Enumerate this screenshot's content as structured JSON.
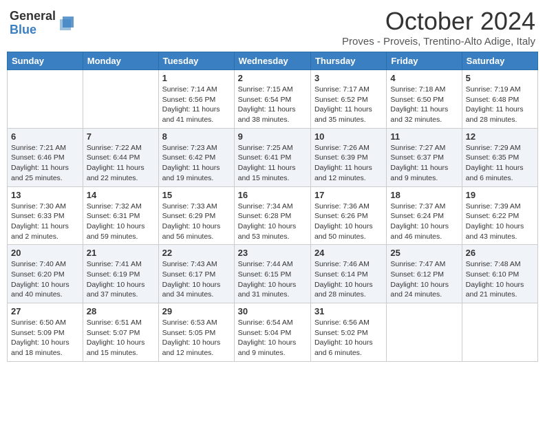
{
  "logo": {
    "general": "General",
    "blue": "Blue"
  },
  "title": "October 2024",
  "location": "Proves - Proveis, Trentino-Alto Adige, Italy",
  "days_of_week": [
    "Sunday",
    "Monday",
    "Tuesday",
    "Wednesday",
    "Thursday",
    "Friday",
    "Saturday"
  ],
  "weeks": [
    [
      {
        "day": "",
        "sunrise": "",
        "sunset": "",
        "daylight": ""
      },
      {
        "day": "",
        "sunrise": "",
        "sunset": "",
        "daylight": ""
      },
      {
        "day": "1",
        "sunrise": "Sunrise: 7:14 AM",
        "sunset": "Sunset: 6:56 PM",
        "daylight": "Daylight: 11 hours and 41 minutes."
      },
      {
        "day": "2",
        "sunrise": "Sunrise: 7:15 AM",
        "sunset": "Sunset: 6:54 PM",
        "daylight": "Daylight: 11 hours and 38 minutes."
      },
      {
        "day": "3",
        "sunrise": "Sunrise: 7:17 AM",
        "sunset": "Sunset: 6:52 PM",
        "daylight": "Daylight: 11 hours and 35 minutes."
      },
      {
        "day": "4",
        "sunrise": "Sunrise: 7:18 AM",
        "sunset": "Sunset: 6:50 PM",
        "daylight": "Daylight: 11 hours and 32 minutes."
      },
      {
        "day": "5",
        "sunrise": "Sunrise: 7:19 AM",
        "sunset": "Sunset: 6:48 PM",
        "daylight": "Daylight: 11 hours and 28 minutes."
      }
    ],
    [
      {
        "day": "6",
        "sunrise": "Sunrise: 7:21 AM",
        "sunset": "Sunset: 6:46 PM",
        "daylight": "Daylight: 11 hours and 25 minutes."
      },
      {
        "day": "7",
        "sunrise": "Sunrise: 7:22 AM",
        "sunset": "Sunset: 6:44 PM",
        "daylight": "Daylight: 11 hours and 22 minutes."
      },
      {
        "day": "8",
        "sunrise": "Sunrise: 7:23 AM",
        "sunset": "Sunset: 6:42 PM",
        "daylight": "Daylight: 11 hours and 19 minutes."
      },
      {
        "day": "9",
        "sunrise": "Sunrise: 7:25 AM",
        "sunset": "Sunset: 6:41 PM",
        "daylight": "Daylight: 11 hours and 15 minutes."
      },
      {
        "day": "10",
        "sunrise": "Sunrise: 7:26 AM",
        "sunset": "Sunset: 6:39 PM",
        "daylight": "Daylight: 11 hours and 12 minutes."
      },
      {
        "day": "11",
        "sunrise": "Sunrise: 7:27 AM",
        "sunset": "Sunset: 6:37 PM",
        "daylight": "Daylight: 11 hours and 9 minutes."
      },
      {
        "day": "12",
        "sunrise": "Sunrise: 7:29 AM",
        "sunset": "Sunset: 6:35 PM",
        "daylight": "Daylight: 11 hours and 6 minutes."
      }
    ],
    [
      {
        "day": "13",
        "sunrise": "Sunrise: 7:30 AM",
        "sunset": "Sunset: 6:33 PM",
        "daylight": "Daylight: 11 hours and 2 minutes."
      },
      {
        "day": "14",
        "sunrise": "Sunrise: 7:32 AM",
        "sunset": "Sunset: 6:31 PM",
        "daylight": "Daylight: 10 hours and 59 minutes."
      },
      {
        "day": "15",
        "sunrise": "Sunrise: 7:33 AM",
        "sunset": "Sunset: 6:29 PM",
        "daylight": "Daylight: 10 hours and 56 minutes."
      },
      {
        "day": "16",
        "sunrise": "Sunrise: 7:34 AM",
        "sunset": "Sunset: 6:28 PM",
        "daylight": "Daylight: 10 hours and 53 minutes."
      },
      {
        "day": "17",
        "sunrise": "Sunrise: 7:36 AM",
        "sunset": "Sunset: 6:26 PM",
        "daylight": "Daylight: 10 hours and 50 minutes."
      },
      {
        "day": "18",
        "sunrise": "Sunrise: 7:37 AM",
        "sunset": "Sunset: 6:24 PM",
        "daylight": "Daylight: 10 hours and 46 minutes."
      },
      {
        "day": "19",
        "sunrise": "Sunrise: 7:39 AM",
        "sunset": "Sunset: 6:22 PM",
        "daylight": "Daylight: 10 hours and 43 minutes."
      }
    ],
    [
      {
        "day": "20",
        "sunrise": "Sunrise: 7:40 AM",
        "sunset": "Sunset: 6:20 PM",
        "daylight": "Daylight: 10 hours and 40 minutes."
      },
      {
        "day": "21",
        "sunrise": "Sunrise: 7:41 AM",
        "sunset": "Sunset: 6:19 PM",
        "daylight": "Daylight: 10 hours and 37 minutes."
      },
      {
        "day": "22",
        "sunrise": "Sunrise: 7:43 AM",
        "sunset": "Sunset: 6:17 PM",
        "daylight": "Daylight: 10 hours and 34 minutes."
      },
      {
        "day": "23",
        "sunrise": "Sunrise: 7:44 AM",
        "sunset": "Sunset: 6:15 PM",
        "daylight": "Daylight: 10 hours and 31 minutes."
      },
      {
        "day": "24",
        "sunrise": "Sunrise: 7:46 AM",
        "sunset": "Sunset: 6:14 PM",
        "daylight": "Daylight: 10 hours and 28 minutes."
      },
      {
        "day": "25",
        "sunrise": "Sunrise: 7:47 AM",
        "sunset": "Sunset: 6:12 PM",
        "daylight": "Daylight: 10 hours and 24 minutes."
      },
      {
        "day": "26",
        "sunrise": "Sunrise: 7:48 AM",
        "sunset": "Sunset: 6:10 PM",
        "daylight": "Daylight: 10 hours and 21 minutes."
      }
    ],
    [
      {
        "day": "27",
        "sunrise": "Sunrise: 6:50 AM",
        "sunset": "Sunset: 5:09 PM",
        "daylight": "Daylight: 10 hours and 18 minutes."
      },
      {
        "day": "28",
        "sunrise": "Sunrise: 6:51 AM",
        "sunset": "Sunset: 5:07 PM",
        "daylight": "Daylight: 10 hours and 15 minutes."
      },
      {
        "day": "29",
        "sunrise": "Sunrise: 6:53 AM",
        "sunset": "Sunset: 5:05 PM",
        "daylight": "Daylight: 10 hours and 12 minutes."
      },
      {
        "day": "30",
        "sunrise": "Sunrise: 6:54 AM",
        "sunset": "Sunset: 5:04 PM",
        "daylight": "Daylight: 10 hours and 9 minutes."
      },
      {
        "day": "31",
        "sunrise": "Sunrise: 6:56 AM",
        "sunset": "Sunset: 5:02 PM",
        "daylight": "Daylight: 10 hours and 6 minutes."
      },
      {
        "day": "",
        "sunrise": "",
        "sunset": "",
        "daylight": ""
      },
      {
        "day": "",
        "sunrise": "",
        "sunset": "",
        "daylight": ""
      }
    ]
  ]
}
